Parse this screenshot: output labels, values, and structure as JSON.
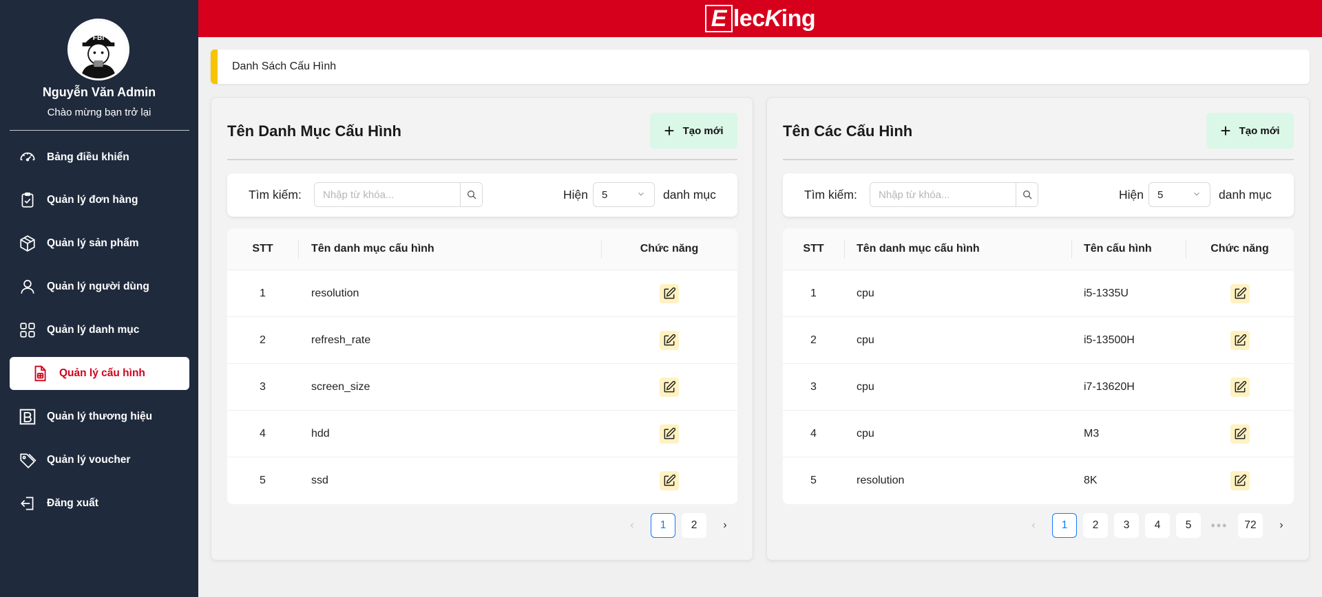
{
  "sidebar": {
    "user_name": "Nguyễn Văn Admin",
    "greeting": "Chào mừng bạn trở lại",
    "avatar_badge": "FBI",
    "items": [
      {
        "label": "Bảng điều khiển",
        "icon": "dashboard-icon"
      },
      {
        "label": "Quản lý đơn hàng",
        "icon": "clipboard-icon"
      },
      {
        "label": "Quản lý sản phẩm",
        "icon": "box-icon"
      },
      {
        "label": "Quản lý người dùng",
        "icon": "user-icon"
      },
      {
        "label": "Quản lý danh mục",
        "icon": "grid-icon"
      },
      {
        "label": "Quản lý cấu hình",
        "icon": "config-file-icon",
        "active": true
      },
      {
        "label": "Quản lý thương hiệu",
        "icon": "brand-b-icon"
      },
      {
        "label": "Quản lý voucher",
        "icon": "tag-icon"
      },
      {
        "label": "Đăng xuất",
        "icon": "logout-icon"
      }
    ]
  },
  "header": {
    "logo_first": "E",
    "logo_middle": "lec",
    "logo_k": "K",
    "logo_end": "ing",
    "bg_color": "#d6001c"
  },
  "breadcrumb": "Danh Sách Cấu Hình",
  "left_panel": {
    "title": "Tên Danh Mục Cấu Hình",
    "create_label": "Tạo mới",
    "search_label": "Tìm kiếm:",
    "search_placeholder": "Nhập từ khóa...",
    "show_label": "Hiện",
    "show_value": "5",
    "unit_label": "danh mục",
    "columns": [
      "STT",
      "Tên danh mục cấu hình",
      "Chức năng"
    ],
    "rows": [
      {
        "stt": "1",
        "name": "resolution"
      },
      {
        "stt": "2",
        "name": "refresh_rate"
      },
      {
        "stt": "3",
        "name": "screen_size"
      },
      {
        "stt": "4",
        "name": "hdd"
      },
      {
        "stt": "5",
        "name": "ssd"
      }
    ],
    "pages": [
      "1",
      "2"
    ],
    "current_page": "1"
  },
  "right_panel": {
    "title": "Tên Các Cấu Hình",
    "create_label": "Tạo mới",
    "search_label": "Tìm kiếm:",
    "search_placeholder": "Nhập từ khóa...",
    "show_label": "Hiện",
    "show_value": "5",
    "unit_label": "danh mục",
    "columns": [
      "STT",
      "Tên danh mục cấu hình",
      "Tên cấu hình",
      "Chức năng"
    ],
    "rows": [
      {
        "stt": "1",
        "category": "cpu",
        "name": "i5-1335U"
      },
      {
        "stt": "2",
        "category": "cpu",
        "name": "i5-13500H"
      },
      {
        "stt": "3",
        "category": "cpu",
        "name": "i7-13620H"
      },
      {
        "stt": "4",
        "category": "cpu",
        "name": "M3"
      },
      {
        "stt": "5",
        "category": "resolution",
        "name": "8K"
      }
    ],
    "pages": [
      "1",
      "2",
      "3",
      "4",
      "5",
      "•••",
      "72"
    ],
    "current_page": "1"
  }
}
